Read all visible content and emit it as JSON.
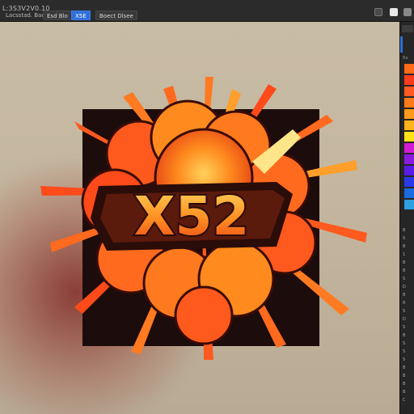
{
  "window": {
    "title": "L:3S3V2V0.10"
  },
  "toolbar": {
    "items": [
      "Lacsstad. Bacan",
      "Esd Blo",
      "X5E",
      "Boect Dlsee"
    ],
    "active_index": 2
  },
  "artwork": {
    "text": "X52"
  },
  "colors": {
    "canvas_bg": "#c6b9a2",
    "art_bg": "#1c0c0c",
    "accent": "#2f6fd8",
    "text_fill": "#ffa028",
    "text_stroke": "#2a0c08"
  },
  "right_panel": {
    "tab_label": "Ba",
    "swatches": [
      "#ff6a1a",
      "#ff3b1e",
      "#ff5a22",
      "#ff7a1a",
      "#ff9a1a",
      "#ffb21a",
      "#ffe21a",
      "#d21ad6",
      "#8a1ae2",
      "#5a1ae8",
      "#2a3ae8",
      "#1a6ae0",
      "#2fa0e0"
    ],
    "layers": [
      "B",
      "S",
      "B",
      "1",
      "B",
      "B",
      "S",
      "D",
      "B",
      "R",
      "S",
      "D",
      "S",
      "B",
      "S",
      "S",
      "S",
      "B",
      "B",
      "B",
      "B",
      "C"
    ]
  }
}
